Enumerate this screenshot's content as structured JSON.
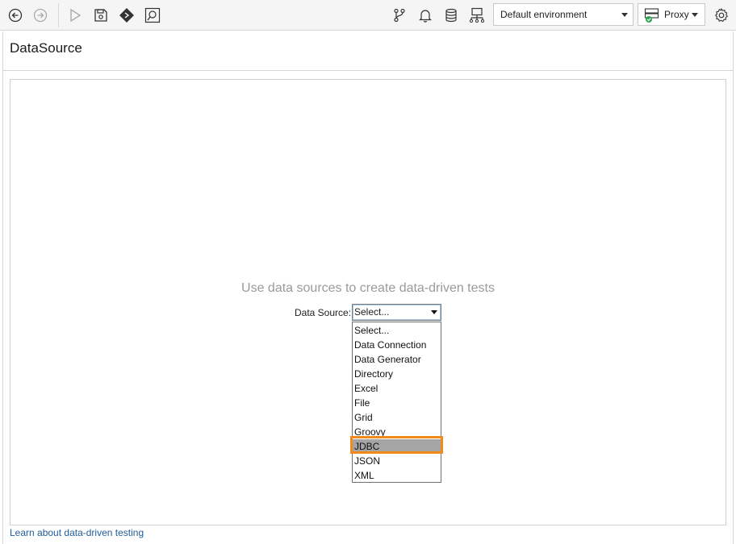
{
  "toolbar": {
    "icons": [
      "back-icon",
      "forward-icon",
      "run-icon",
      "save-icon",
      "diamond-icon",
      "search-log-icon",
      "branch-icon",
      "bell-icon",
      "database-icon",
      "network-icon",
      "gear-icon"
    ],
    "environment": "Default environment",
    "proxy_label": "Proxy"
  },
  "page": {
    "title": "DataSource",
    "hint": "Use data sources to create data-driven tests",
    "data_source_label": "Data Source:",
    "selected": "Select...",
    "options": [
      "Select...",
      "Data Connection",
      "Data Generator",
      "Directory",
      "Excel",
      "File",
      "Grid",
      "Groovy",
      "JDBC",
      "JSON",
      "XML"
    ],
    "highlighted": "JDBC",
    "learn_link": "Learn about data-driven testing"
  },
  "colors": {
    "highlight_outline": "#f08a1c",
    "link": "#1f5b99",
    "hint_text": "#9a9a9a"
  }
}
